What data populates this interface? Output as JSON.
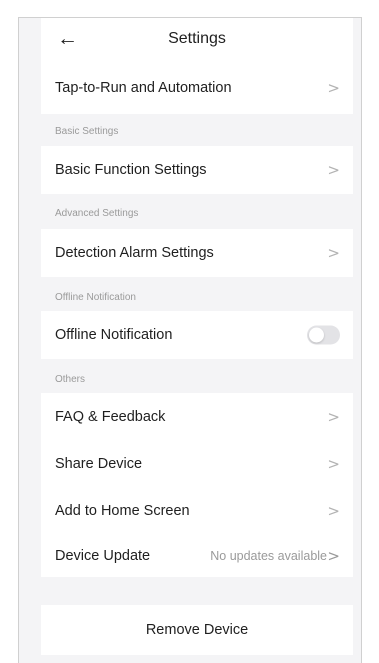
{
  "header": {
    "back_glyph": "←",
    "title": "Settings"
  },
  "rows": {
    "tap_to_run": {
      "label": "Tap-to-Run and Automation",
      "chevron": ">"
    },
    "basic_function": {
      "label": "Basic Function Settings",
      "chevron": ">"
    },
    "detection_alarm": {
      "label": "Detection Alarm Settings",
      "chevron": ">"
    },
    "offline_notification": {
      "label": "Offline Notification",
      "toggle_on": false
    },
    "faq_feedback": {
      "label": "FAQ & Feedback",
      "chevron": ">"
    },
    "share_device": {
      "label": "Share Device",
      "chevron": ">"
    },
    "add_home_screen": {
      "label": "Add to Home Screen",
      "chevron": ">"
    },
    "device_update": {
      "label": "Device Update",
      "value": "No updates available",
      "chevron": ">"
    }
  },
  "sections": {
    "basic": "Basic Settings",
    "advanced": "Advanced Settings",
    "offline": "Offline Notification",
    "others": "Others"
  },
  "remove_device": {
    "label": "Remove Device"
  },
  "colors": {
    "background": "#f4f4f6",
    "card": "#ffffff",
    "text": "#1f1f1f",
    "muted": "#9a9a9a",
    "chevron": "#b3b3b3",
    "toggle_off": "#e3e3e6"
  },
  "icons": {
    "back": "back-arrow-icon",
    "chevron": "chevron-right-icon"
  }
}
